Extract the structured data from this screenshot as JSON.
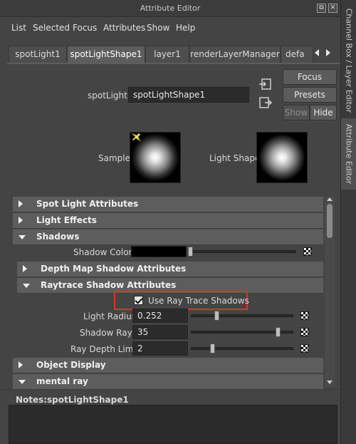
{
  "window": {
    "title": "Attribute Editor",
    "float_glyph": "⧉",
    "close_glyph": "✕"
  },
  "dock_tabs": [
    "Channel Box / Layer Editor",
    "Attribute Editor"
  ],
  "menu": [
    "List",
    "Selected",
    "Focus",
    "Attributes",
    "Show",
    "Help"
  ],
  "node_tabs": [
    "spotLight1",
    "spotLightShape1",
    "layer1",
    "renderLayerManager",
    "defa"
  ],
  "active_tab": "spotLightShape1",
  "side_buttons": {
    "focus": "Focus",
    "presets": "Presets",
    "show": "Show",
    "hide": "Hide"
  },
  "node": {
    "label": "spotLight:",
    "value": "spotLightShape1"
  },
  "swatches": {
    "sample_label": "Sample",
    "light_shape_label": "Light Shape"
  },
  "sections": {
    "spot_light_attributes": "Spot Light Attributes",
    "light_effects": "Light Effects",
    "shadows": "Shadows",
    "depth_map": "Depth Map Shadow Attributes",
    "raytrace": "Raytrace Shadow Attributes",
    "object_display": "Object Display",
    "mental_ray": "mental ray"
  },
  "shadow_color": {
    "label": "Shadow Color",
    "slider": 0.0
  },
  "raytrace": {
    "use_label": "Use Ray Trace Shadows",
    "use_checked": true,
    "light_radius": {
      "label": "Light Radius",
      "value": "0.252",
      "slider": 0.252
    },
    "shadow_rays": {
      "label": "Shadow Rays",
      "value": "35",
      "slider": 0.97
    },
    "ray_depth_limit": {
      "label": "Ray Depth Limit",
      "value": "2",
      "slider": 0.2
    }
  },
  "notes": {
    "label": "Notes:",
    "value": "spotLightShape1"
  },
  "colors": {
    "highlight_box": "#e03030",
    "header": "#5d5d5d",
    "field": "#2b2b2b"
  }
}
